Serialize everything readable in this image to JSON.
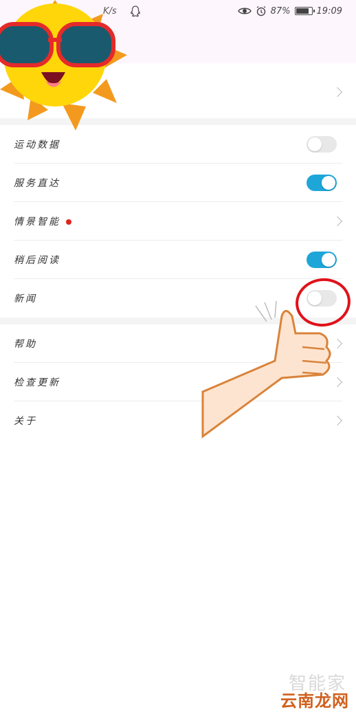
{
  "status_bar": {
    "speed": "K/s",
    "battery": "87%",
    "time": "19:09",
    "icons": [
      "qq-icon",
      "eye-icon",
      "alarm-icon",
      "battery-icon"
    ]
  },
  "settings": {
    "items": [
      {
        "label": "运动数据",
        "control": "toggle",
        "on": false
      },
      {
        "label": "服务直达",
        "control": "toggle",
        "on": true
      },
      {
        "label": "情景智能",
        "control": "chevron",
        "badge": true
      },
      {
        "label": "稍后阅读",
        "control": "toggle",
        "on": true
      },
      {
        "label": "新闻",
        "control": "toggle",
        "on": false
      }
    ],
    "more_items": [
      {
        "label": "帮助"
      },
      {
        "label": "检查更新"
      },
      {
        "label": "关于"
      }
    ]
  },
  "colors": {
    "toggle_on": "#1ea6d8",
    "badge": "#e0261d",
    "highlight": "#e0121a"
  },
  "watermark": {
    "top": "智能家",
    "bottom": "云南龙网"
  }
}
